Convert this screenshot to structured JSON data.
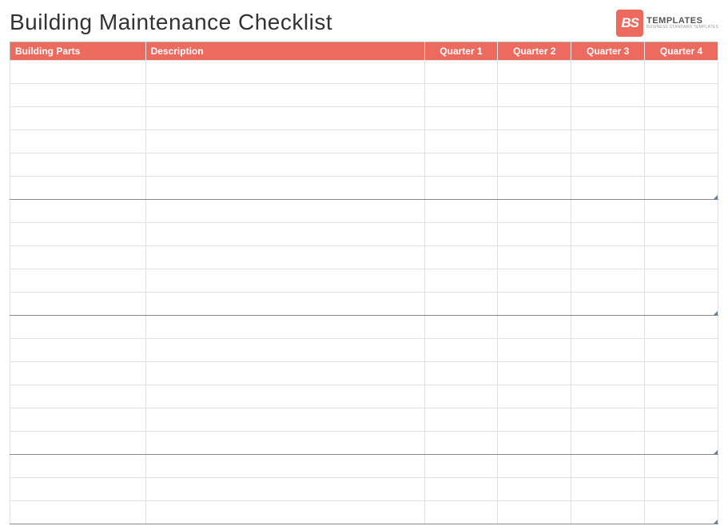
{
  "title": "Building Maintenance Checklist",
  "logo": {
    "badge": "BS",
    "main": "TEMPLATES",
    "sub": "BUSINESS STANDARD TEMPLATES"
  },
  "columns": {
    "parts": "Building Parts",
    "description": "Description",
    "q1": "Quarter 1",
    "q2": "Quarter 2",
    "q3": "Quarter 3",
    "q4": "Quarter 4"
  },
  "sections": [
    {
      "rows": 6
    },
    {
      "rows": 5
    },
    {
      "rows": 6
    },
    {
      "rows": 3
    }
  ]
}
